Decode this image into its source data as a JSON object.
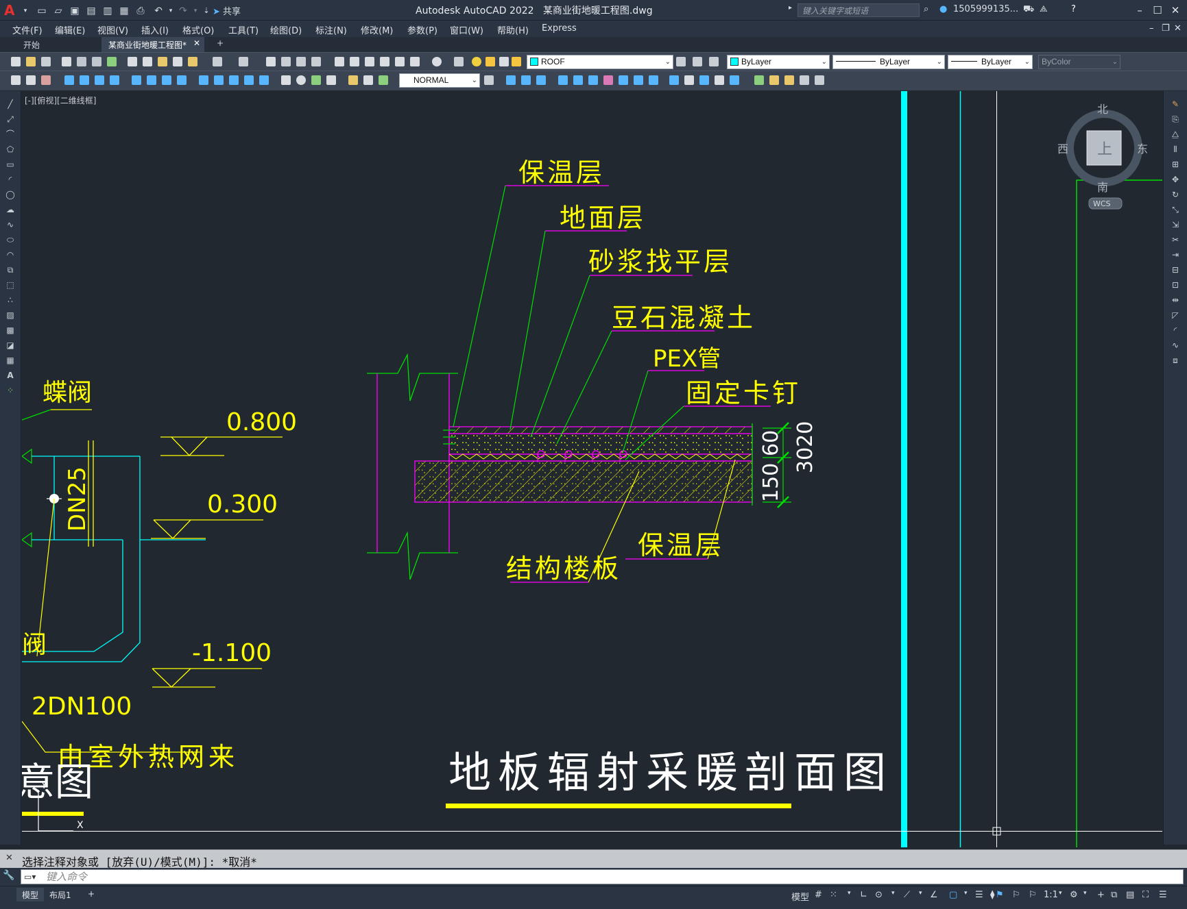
{
  "titlebar": {
    "share_label": "共享",
    "app_name": "Autodesk AutoCAD 2022",
    "file_name": "某商业街地暖工程图.dwg",
    "search_placeholder": "键入关键字或短语",
    "user": "1505999135...",
    "help": "?"
  },
  "menu": [
    "文件(F)",
    "编辑(E)",
    "视图(V)",
    "插入(I)",
    "格式(O)",
    "工具(T)",
    "绘图(D)",
    "标注(N)",
    "修改(M)",
    "参数(P)",
    "窗口(W)",
    "帮助(H)",
    "Express"
  ],
  "tabs": [
    {
      "label": "开始",
      "active": false
    },
    {
      "label": "某商业街地暖工程图*",
      "active": true
    }
  ],
  "layer_combo": {
    "value": "ROOF",
    "color": "#00ffff"
  },
  "color_combo": {
    "value": "ByLayer"
  },
  "linetype_combo": {
    "value": "ByLayer"
  },
  "lineweight_combo": {
    "value": "ByLayer"
  },
  "plotstyle_combo": {
    "value": "ByColor"
  },
  "dimstyle_combo": {
    "value": "NORMAL"
  },
  "viewport_label": "[-][俯视][二维线框]",
  "viewcube": {
    "north": "北",
    "south": "南",
    "east": "东",
    "west": "西",
    "face": "上",
    "wcs": "WCS"
  },
  "drawing": {
    "valve_label": "蝶阀",
    "pipe_label": "DN25",
    "level1": "0.800",
    "level2": "0.300",
    "level3": "-1.100",
    "partial_valve": "阀",
    "main_pipe": "2DN100",
    "source_label": "由室外热网来",
    "left_title_partial": "意图",
    "layer_insulation": "保温层",
    "layer_floor": "地面层",
    "layer_mortar": "砂浆找平层",
    "layer_concrete": "豆石混凝土",
    "layer_pex": "PEX管",
    "layer_clip": "固定卡钉",
    "layer_slab": "结构楼板",
    "layer_insulation2": "保温层",
    "dim_150": "150",
    "dim_60": "60",
    "dim_3020": "3020",
    "main_title": "地板辐射采暖剖面图"
  },
  "command": {
    "history": "选择注释对象或 [放弃(U)/模式(M)]: *取消*",
    "placeholder": "键入命令"
  },
  "status": {
    "layout_tabs": [
      "模型",
      "布局1"
    ],
    "model_label": "模型",
    "scale": "1:1"
  },
  "colors": {
    "background": "#212830",
    "yellow": "#ffff00",
    "green": "#00e000",
    "cyan": "#00ffff",
    "magenta": "#ff00ff",
    "white": "#ffffff"
  }
}
